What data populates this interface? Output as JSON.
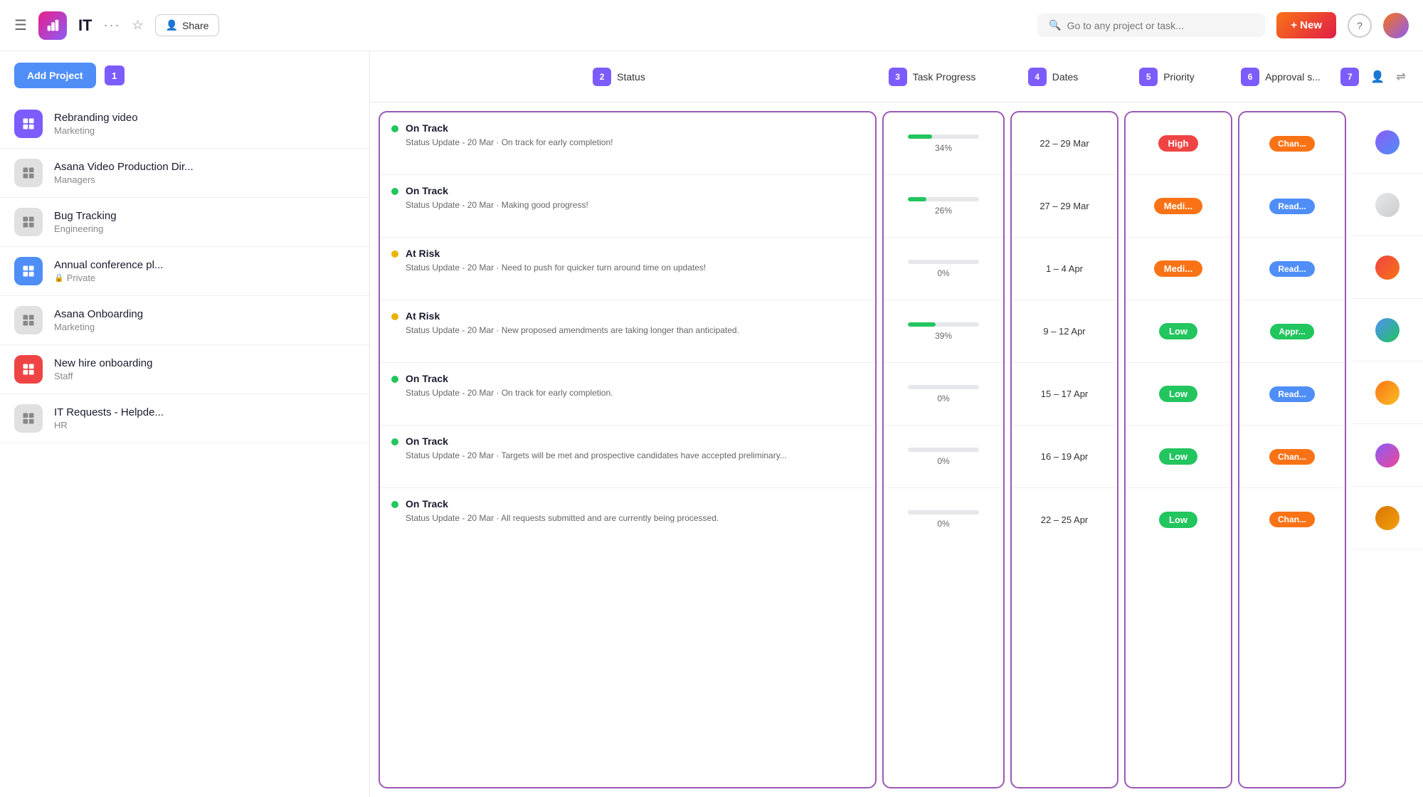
{
  "navbar": {
    "title": "IT",
    "share_label": "Share",
    "search_placeholder": "Go to any project or task...",
    "new_label": "+ New",
    "col_nums": [
      "2",
      "3",
      "4",
      "5",
      "6",
      "7"
    ]
  },
  "sidebar": {
    "add_project_label": "Add Project",
    "num_badge": "1",
    "projects": [
      {
        "name": "Rebranding video",
        "sub": "Marketing",
        "icon_color": "purple",
        "private": false
      },
      {
        "name": "Asana Video Production Dir...",
        "sub": "Managers",
        "icon_color": "gray",
        "private": false
      },
      {
        "name": "Bug Tracking",
        "sub": "Engineering",
        "icon_color": "gray",
        "private": false
      },
      {
        "name": "Annual conference pl...",
        "sub": "Private",
        "icon_color": "blue",
        "private": true
      },
      {
        "name": "Asana Onboarding",
        "sub": "Marketing",
        "icon_color": "gray",
        "private": false
      },
      {
        "name": "New hire onboarding",
        "sub": "Staff",
        "icon_color": "red",
        "private": false
      },
      {
        "name": "IT Requests - Helpde...",
        "sub": "HR",
        "icon_color": "gray",
        "private": false
      }
    ]
  },
  "columns": {
    "status_label": "Status",
    "progress_label": "Task Progress",
    "dates_label": "Dates",
    "priority_label": "Priority",
    "approval_label": "Approval s...",
    "nums": {
      "status": "2",
      "progress": "3",
      "dates": "4",
      "priority": "5",
      "approval": "6",
      "extra1": "7"
    }
  },
  "rows": [
    {
      "status_type": "On Track",
      "status_dot": "green",
      "status_desc": "Status Update - 20 Mar · On track for early completion!",
      "progress": 34,
      "progress_color": "#22c55e",
      "dates": "22 – 29 Mar",
      "priority": "High",
      "priority_class": "high",
      "approval": "Chan...",
      "approval_class": "chan",
      "avatar_bg": "#8b5cf6"
    },
    {
      "status_type": "On Track",
      "status_dot": "green",
      "status_desc": "Status Update - 20 Mar · Making good progress!",
      "progress": 26,
      "progress_color": "#22c55e",
      "dates": "27 – 29 Mar",
      "priority": "Medi...",
      "priority_class": "medium",
      "approval": "Read...",
      "approval_class": "read",
      "avatar_bg": "#e5e7eb"
    },
    {
      "status_type": "At Risk",
      "status_dot": "yellow",
      "status_desc": "Status Update - 20 Mar · Need to push for quicker turn around time on updates!",
      "progress": 0,
      "progress_color": "#22c55e",
      "dates": "1 – 4 Apr",
      "priority": "Medi...",
      "priority_class": "medium",
      "approval": "Read...",
      "approval_class": "read",
      "avatar_bg": "#ef4444"
    },
    {
      "status_type": "At Risk",
      "status_dot": "yellow",
      "status_desc": "Status Update - 20 Mar · New proposed amendments are taking longer than anticipated.",
      "progress": 39,
      "progress_color": "#22c55e",
      "dates": "9 – 12 Apr",
      "priority": "Low",
      "priority_class": "low",
      "approval": "Appr...",
      "approval_class": "appr",
      "avatar_bg": "#4f8ef7"
    },
    {
      "status_type": "On Track",
      "status_dot": "green",
      "status_desc": "Status Update - 20 Mar · On track for early completion.",
      "progress": 0,
      "progress_color": "#22c55e",
      "dates": "15 – 17 Apr",
      "priority": "Low",
      "priority_class": "low",
      "approval": "Read...",
      "approval_class": "read",
      "avatar_bg": "#f97316"
    },
    {
      "status_type": "On Track",
      "status_dot": "green",
      "status_desc": "Status Update - 20 Mar · Targets will be met and prospective candidates have accepted preliminary...",
      "progress": 0,
      "progress_color": "#22c55e",
      "dates": "16 – 19 Apr",
      "priority": "Low",
      "priority_class": "low",
      "approval": "Chan...",
      "approval_class": "chan",
      "avatar_bg": "#8b5cf6"
    },
    {
      "status_type": "On Track",
      "status_dot": "green",
      "status_desc": "Status Update - 20 Mar · All requests submitted and are currently being processed.",
      "progress": 0,
      "progress_color": "#22c55e",
      "dates": "22 – 25 Apr",
      "priority": "Low",
      "priority_class": "low",
      "approval": "Chan...",
      "approval_class": "chan",
      "avatar_bg": "#d97706"
    }
  ]
}
